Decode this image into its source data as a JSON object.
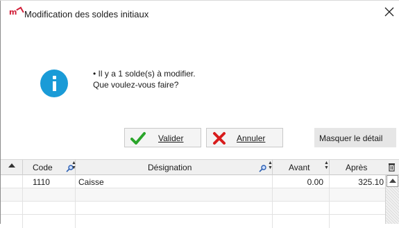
{
  "window": {
    "app_logo": "m",
    "title": "Modification des soldes initiaux",
    "close_icon": "close-icon"
  },
  "message": {
    "icon": "info-icon",
    "icon_color": "#1a9bd7",
    "line1": "• Il y a 1 solde(s) à modifier.",
    "line2": "Que voulez-vous  faire?"
  },
  "buttons": {
    "valider_label": "Valider",
    "valider_icon": "check-icon",
    "valider_icon_color": "#2aa52a",
    "annuler_label": "Annuler",
    "annuler_icon": "x-icon",
    "annuler_icon_color": "#d81c1c",
    "masquer_label": "Masquer le détail"
  },
  "grid": {
    "columns": [
      {
        "key": "code",
        "label": "Code"
      },
      {
        "key": "designation",
        "label": "Désignation"
      },
      {
        "key": "avant",
        "label": "Avant"
      },
      {
        "key": "apres",
        "label": "Après"
      }
    ],
    "rows": [
      {
        "code": "1110",
        "designation": "Caisse",
        "avant": "0.00",
        "apres": "325.10"
      }
    ],
    "empty_rows": 2
  }
}
